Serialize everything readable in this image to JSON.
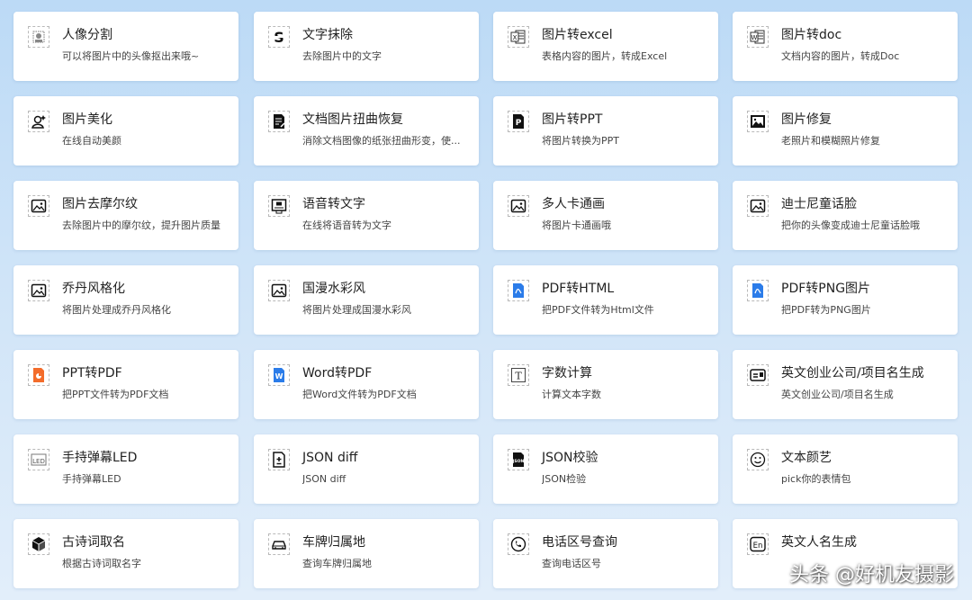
{
  "tools": [
    {
      "title": "人像分割",
      "desc": "可以将图片中的头像抠出来哦~",
      "icon": "portrait-cutout-icon"
    },
    {
      "title": "文字抹除",
      "desc": "去除图片中的文字",
      "icon": "text-erase-icon"
    },
    {
      "title": "图片转excel",
      "desc": "表格内容的图片，转成Excel",
      "icon": "excel-icon"
    },
    {
      "title": "图片转doc",
      "desc": "文档内容的图片，转成Doc",
      "icon": "word-doc-icon"
    },
    {
      "title": "图片美化",
      "desc": "在线自动美颜",
      "icon": "face-beautify-icon"
    },
    {
      "title": "文档图片扭曲恢复",
      "desc": "消除文档图像的纸张扭曲形变，使...",
      "icon": "document-restore-icon"
    },
    {
      "title": "图片转PPT",
      "desc": "将图片转换为PPT",
      "icon": "ppt-icon"
    },
    {
      "title": "图片修复",
      "desc": "老照片和模糊照片修复",
      "icon": "photo-repair-icon"
    },
    {
      "title": "图片去摩尔纹",
      "desc": "去除图片中的摩尔纹，提升图片质量",
      "icon": "image-icon"
    },
    {
      "title": "语音转文字",
      "desc": "在线将语音转为文字",
      "icon": "speech-to-text-icon"
    },
    {
      "title": "多人卡通画",
      "desc": "将图片卡通画哦",
      "icon": "image-icon"
    },
    {
      "title": "迪士尼童话脸",
      "desc": "把你的头像变成迪士尼童话脸哦",
      "icon": "image-icon"
    },
    {
      "title": "乔丹风格化",
      "desc": "将图片处理成乔丹风格化",
      "icon": "image-icon"
    },
    {
      "title": "国漫水彩风",
      "desc": "将图片处理成国漫水彩风",
      "icon": "image-icon"
    },
    {
      "title": "PDF转HTML",
      "desc": "把PDF文件转为Html文件",
      "icon": "pdf-file-icon"
    },
    {
      "title": "PDF转PNG图片",
      "desc": "把PDF转为PNG图片",
      "icon": "pdf-file-icon"
    },
    {
      "title": "PPT转PDF",
      "desc": "把PPT文件转为PDF文档",
      "icon": "ppt-file-icon"
    },
    {
      "title": "Word转PDF",
      "desc": "把Word文件转为PDF文档",
      "icon": "word-file-icon"
    },
    {
      "title": "字数计算",
      "desc": "计算文本字数",
      "icon": "text-t-icon"
    },
    {
      "title": "英文创业公司/项目名生成",
      "desc": "英文创业公司/项目名生成",
      "icon": "id-card-icon"
    },
    {
      "title": "手持弹幕LED",
      "desc": "手持弹幕LED",
      "icon": "led-icon"
    },
    {
      "title": "JSON diff",
      "desc": "JSON diff",
      "icon": "json-diff-icon"
    },
    {
      "title": "JSON校验",
      "desc": "JSON检验",
      "icon": "json-file-icon"
    },
    {
      "title": "文本颜艺",
      "desc": "pick你的表情包",
      "icon": "smiley-icon"
    },
    {
      "title": "古诗词取名",
      "desc": "根据古诗词取名字",
      "icon": "cube-icon"
    },
    {
      "title": "车牌归属地",
      "desc": "查询车牌归属地",
      "icon": "car-icon"
    },
    {
      "title": "电话区号查询",
      "desc": "查询电话区号",
      "icon": "phone-icon"
    },
    {
      "title": "英文人名生成",
      "desc": "",
      "icon": "en-icon"
    }
  ],
  "colors": {
    "card_bg": "#ffffff",
    "page_bg_top": "#bcdaf6",
    "page_bg_bottom": "#e2eefa",
    "pdf_blue": "#2b7ce9",
    "ppt_orange": "#f36c2b"
  },
  "watermark": "头条 @好机友摄影"
}
